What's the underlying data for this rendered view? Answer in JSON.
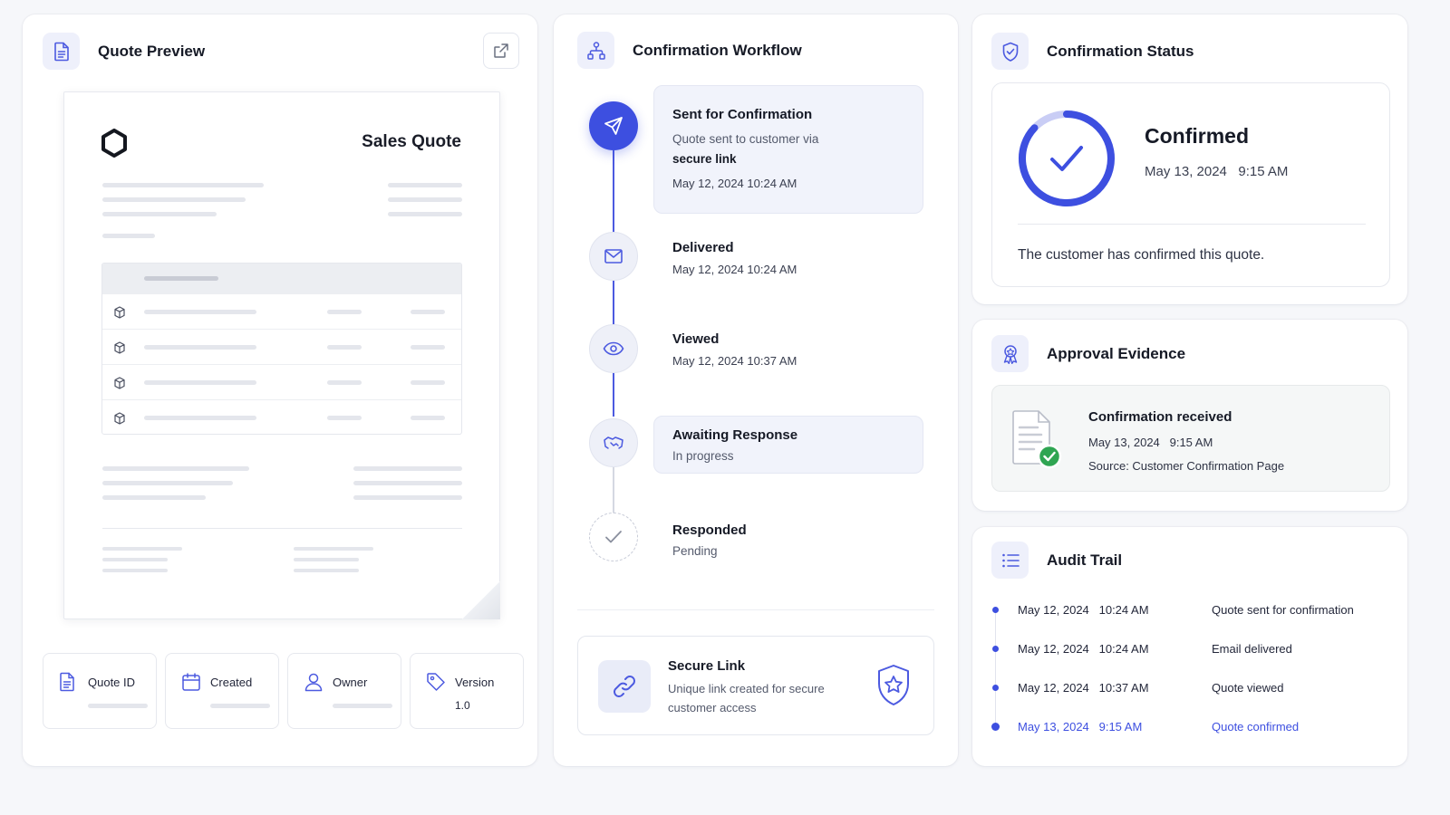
{
  "quote_preview": {
    "title": "Quote Preview",
    "doc_title": "Sales Quote",
    "meta": [
      {
        "label": "Quote ID",
        "value": ""
      },
      {
        "label": "Created",
        "value": ""
      },
      {
        "label": "Owner",
        "value": ""
      },
      {
        "label": "Version",
        "value": "1.0"
      }
    ]
  },
  "workflow": {
    "title": "Confirmation Workflow",
    "steps": [
      {
        "title": "Sent for Confirmation",
        "sub": "Quote sent to customer via",
        "sub_bold": "secure link",
        "time": "May 12, 2024  10:24 AM"
      },
      {
        "title": "Delivered",
        "time": "May 12, 2024  10:24 AM"
      },
      {
        "title": "Viewed",
        "time": "May 12, 2024  10:37 AM"
      },
      {
        "title": "Awaiting Response",
        "sub": "In progress"
      },
      {
        "title": "Responded",
        "sub": "Pending"
      }
    ],
    "secure_link": {
      "title": "Secure Link",
      "desc": "Unique link created for secure customer access"
    }
  },
  "status": {
    "title": "Confirmation Status",
    "state": "Confirmed",
    "time": "May 13, 2024   9:15 AM",
    "message": "The customer has confirmed this quote."
  },
  "evidence": {
    "title": "Approval Evidence",
    "item_title": "Confirmation received",
    "time": "May 13, 2024   9:15 AM",
    "source": "Source: Customer Confirmation Page"
  },
  "audit": {
    "title": "Audit Trail",
    "items": [
      {
        "time": "May 12, 2024   10:24 AM",
        "event": "Quote sent for confirmation"
      },
      {
        "time": "May 12, 2024   10:24 AM",
        "event": "Email delivered"
      },
      {
        "time": "May 12, 2024   10:37 AM",
        "event": "Quote viewed"
      },
      {
        "time": "May 13, 2024   9:15 AM",
        "event": "Quote confirmed"
      }
    ]
  },
  "colors": {
    "accent": "#3d4fe0",
    "success": "#2fa552"
  }
}
